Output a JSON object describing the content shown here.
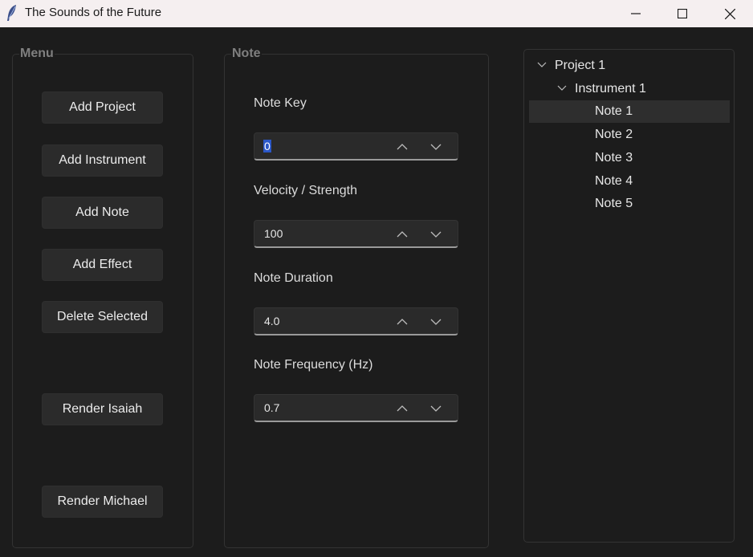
{
  "window": {
    "title": "The Sounds of the Future",
    "icon": "feather-icon"
  },
  "menu": {
    "label": "Menu",
    "buttons": [
      "Add Project",
      "Add Instrument",
      "Add Note",
      "Add Effect",
      "Delete Selected",
      "Render Isaiah",
      "Render Michael"
    ]
  },
  "note": {
    "label": "Note",
    "fields": [
      {
        "label": "Note Key",
        "value": "0"
      },
      {
        "label": "Velocity / Strength",
        "value": "100"
      },
      {
        "label": "Note Duration",
        "value": "4.0"
      },
      {
        "label": "Note Frequency (Hz)",
        "value": "0.7"
      }
    ]
  },
  "tree": {
    "project": "Project 1",
    "instrument": "Instrument 1",
    "notes": [
      "Note 1",
      "Note 2",
      "Note 3",
      "Note 4",
      "Note 5"
    ],
    "selected": "Note 1"
  },
  "colors": {
    "background": "#1c1c1c",
    "titlebar": "#f5eff0",
    "button": "#2b2b2b",
    "selection": "#2b57c7",
    "tree_selected": "#2e2e2e"
  }
}
